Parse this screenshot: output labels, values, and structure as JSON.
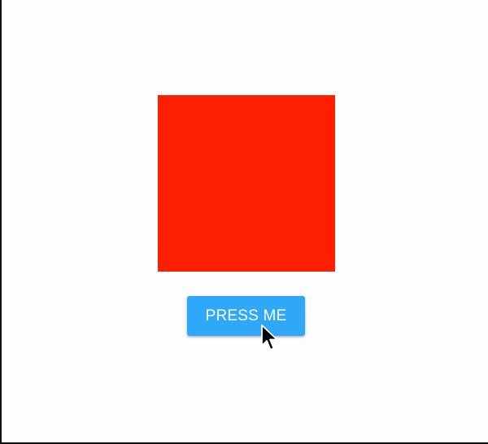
{
  "colors": {
    "square": "#fd2000",
    "button": "#2fa8f9",
    "button_text": "#ffffff"
  },
  "button": {
    "label": "PRESS ME"
  },
  "cursor": {
    "icon": "arrow-pointer-icon"
  }
}
